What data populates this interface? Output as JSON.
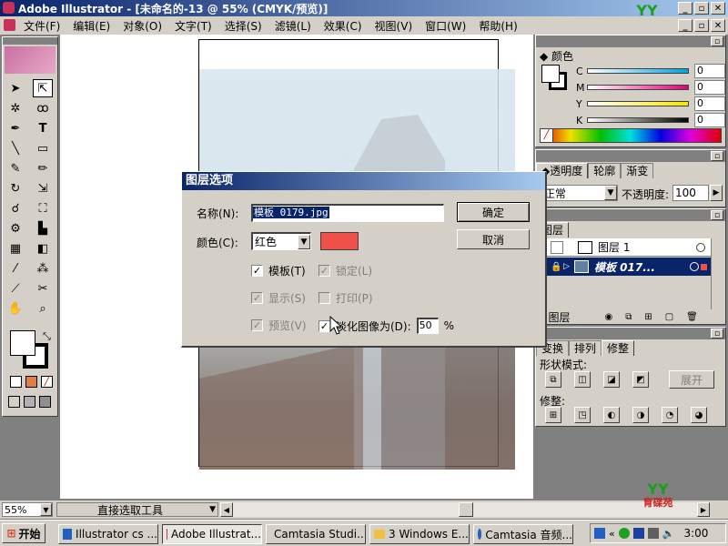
{
  "window": {
    "title": "Adobe Illustrator - [未命名的-13 @ 55% (CMYK/预览)]"
  },
  "menu": [
    "文件(F)",
    "编辑(E)",
    "对象(O)",
    "文字(T)",
    "选择(S)",
    "滤镜(L)",
    "效果(C)",
    "视图(V)",
    "窗口(W)",
    "帮助(H)"
  ],
  "logo": {
    "text": "育碟苑",
    "letters": "YY"
  },
  "color_panel": {
    "tab": "颜色",
    "channels": [
      {
        "label": "C",
        "value": "0"
      },
      {
        "label": "M",
        "value": "0"
      },
      {
        "label": "Y",
        "value": "0"
      },
      {
        "label": "K",
        "value": "0"
      }
    ]
  },
  "transparency_panel": {
    "tabs": [
      "透明度",
      "轮廓",
      "渐变"
    ],
    "blend_mode": "正常",
    "opacity_label": "不透明度:",
    "opacity_value": "100"
  },
  "layers_panel": {
    "tab": "图层",
    "layers": [
      {
        "name": "图层 1"
      },
      {
        "name": "模板 017..."
      }
    ],
    "footer_label": "2 图层"
  },
  "pathfinder_panel": {
    "tabs": [
      "变换",
      "排列",
      "修整"
    ],
    "shape_mode_label": "形状模式:",
    "expand_button": "展开",
    "pathfinders_label": "修整:"
  },
  "dialog": {
    "title": "图层选项",
    "name_label": "名称(N):",
    "name_value": "模板 0179.jpg",
    "color_label": "颜色(C):",
    "color_value": "红色",
    "swatch_color": "#f0504a",
    "ok_button": "确定",
    "cancel_button": "取消",
    "options": {
      "template": "模板(T)",
      "lock": "锁定(L)",
      "show": "显示(S)",
      "print": "打印(P)",
      "preview": "预览(V)",
      "dim": "淡化图像为(D):",
      "dim_value": "50",
      "percent": "%"
    }
  },
  "statusbar": {
    "zoom": "55%",
    "tool_name": "直接选取工具"
  },
  "taskbar": {
    "start": "开始",
    "tasks": [
      "Illustrator cs ...",
      "Adobe Illustrat...",
      "Camtasia Studi...",
      "3 Windows E...",
      "Camtasia 音频..."
    ],
    "clock": "3:00"
  }
}
